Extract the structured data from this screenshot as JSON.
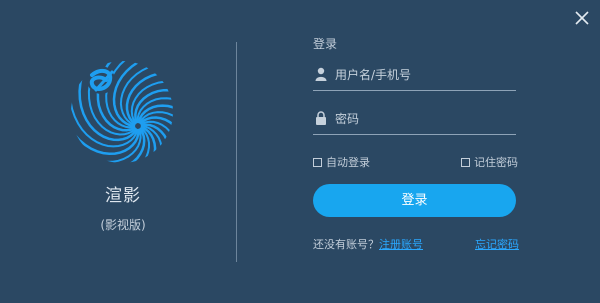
{
  "window": {
    "close_icon": "close-icon"
  },
  "brand": {
    "logo_icon": "swirl-logo-icon",
    "name": "渲影",
    "subtitle": "(影视版)",
    "logo_color": "#1e9ef0"
  },
  "login": {
    "title": "登录",
    "username_placeholder": "用户名/手机号",
    "password_placeholder": "密码",
    "auto_login_label": "自动登录",
    "remember_password_label": "记住密码",
    "login_button_label": "登录",
    "no_account_text": "还没有账号？",
    "register_link": "注册账号",
    "forgot_password_link": "忘记密码"
  },
  "colors": {
    "background": "#2b4863",
    "accent": "#18a6ef",
    "link": "#2aa8ff"
  }
}
